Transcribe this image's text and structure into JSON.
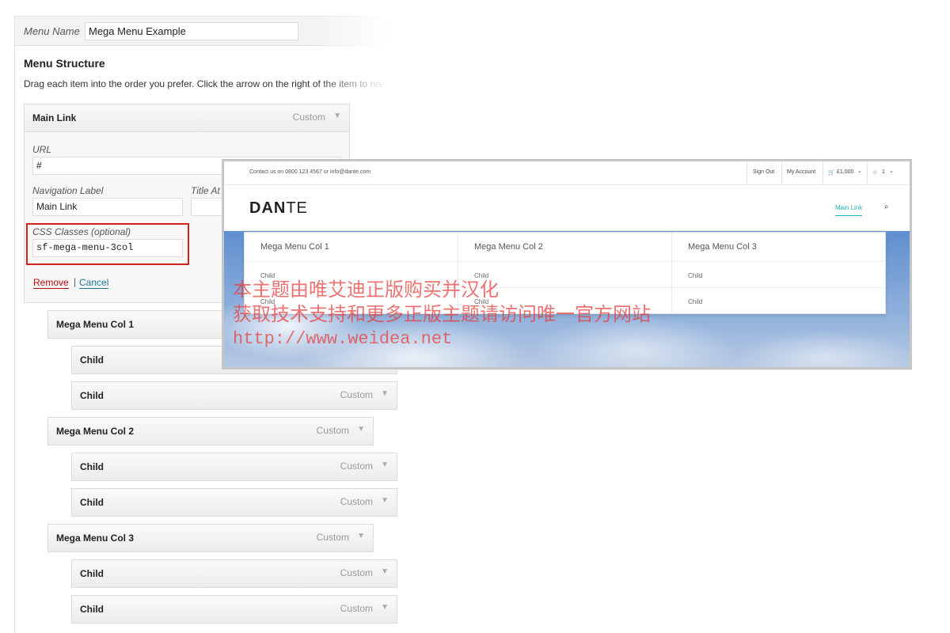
{
  "menu_name": {
    "label": "Menu Name",
    "value": "Mega Menu Example"
  },
  "structure": {
    "title": "Menu Structure",
    "help": "Drag each item into the order you prefer. Click the arrow on the right of the item to rev"
  },
  "main_item": {
    "title": "Main Link",
    "type": "Custom",
    "url_label": "URL",
    "url_value": "#",
    "nav_label": "Navigation Label",
    "nav_value": "Main Link",
    "title_attr_label": "Title At",
    "css_label": "CSS Classes (optional)",
    "css_value": "sf-mega-menu-3col",
    "remove": "Remove",
    "separator": "|",
    "cancel": "Cancel"
  },
  "menu_items": [
    {
      "title": "Mega Menu Col 1",
      "type": "Custom"
    },
    {
      "title": "Child",
      "type": "Custom"
    },
    {
      "title": "Child",
      "type": "Custom"
    },
    {
      "title": "Mega Menu Col 2",
      "type": "Custom"
    },
    {
      "title": "Child",
      "type": "Custom"
    },
    {
      "title": "Child",
      "type": "Custom"
    },
    {
      "title": "Mega Menu Col 3",
      "type": "Custom"
    },
    {
      "title": "Child",
      "type": "Custom"
    },
    {
      "title": "Child",
      "type": "Custom"
    }
  ],
  "preview": {
    "contact": "Contact us on 0800 123 4567 or info@dante.com",
    "sign_out": "Sign Out",
    "my_account": "My Account",
    "cart": "£1,000",
    "wishlist": "1",
    "logo_bold": "DAN",
    "logo_light": "TE",
    "nav_link": "Main Link",
    "mega_columns": [
      {
        "title": "Mega Menu Col 1",
        "children": [
          "Child",
          "Child"
        ]
      },
      {
        "title": "Mega Menu Col 2",
        "children": [
          "Child",
          "Child"
        ]
      },
      {
        "title": "Mega Menu Col 3",
        "children": [
          "Child",
          "Child"
        ]
      }
    ]
  },
  "watermark": {
    "line1": "本主题由唯艾迪正版购买并汉化",
    "line2": "获取技术支持和更多正版主题请访问唯一官方网站",
    "line3": "http://www.weidea.net"
  },
  "icons": {
    "arrow": "▼",
    "cart": "🛒",
    "star": "☆",
    "chevron": "⌄",
    "search": "⌕"
  },
  "colors": {
    "accent_teal": "#1fb3b3",
    "remove_red": "#bc0b0b",
    "link_blue": "#21759b",
    "highlight_red": "#d42020"
  }
}
